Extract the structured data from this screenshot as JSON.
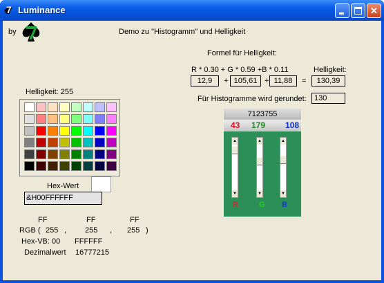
{
  "window": {
    "title": "Luminance"
  },
  "header": {
    "by": "by",
    "demo": "Demo zu \"Histogramm\" und Helligkeit"
  },
  "formula": {
    "title": "Formel für Helligkeit:",
    "expr": "R * 0.30  +  G * 0.59  +B  * 0.11",
    "result_label": "Helligkeit:",
    "r_term": "12,9",
    "g_term": "105,61",
    "b_term": "11,88",
    "plus1": "+",
    "plus2": "+",
    "equals": "=",
    "result": "130,39",
    "rounded_label": "Für Histogramme wird gerundet:",
    "rounded_value": "130"
  },
  "palette": {
    "brightness_label": "Helligkeit: 255",
    "colors": [
      [
        "#ffffff",
        "#ffc0c0",
        "#ffe0c0",
        "#ffffc0",
        "#c0ffc0",
        "#c0ffff",
        "#c0c0ff",
        "#ffc0ff"
      ],
      [
        "#e0e0e0",
        "#ff8080",
        "#ffc080",
        "#ffff80",
        "#80ff80",
        "#80ffff",
        "#8080ff",
        "#ff80ff"
      ],
      [
        "#c0c0c0",
        "#ff0000",
        "#ff8000",
        "#ffff00",
        "#00ff00",
        "#00ffff",
        "#0000ff",
        "#ff00ff"
      ],
      [
        "#808080",
        "#c00000",
        "#c04000",
        "#c0c000",
        "#00c000",
        "#00c0c0",
        "#0000c0",
        "#c000c0"
      ],
      [
        "#404040",
        "#800000",
        "#804000",
        "#808000",
        "#008000",
        "#008080",
        "#000080",
        "#800080"
      ],
      [
        "#000000",
        "#400000",
        "#402000",
        "#404000",
        "#004000",
        "#004040",
        "#000040",
        "#400040"
      ]
    ]
  },
  "hex": {
    "label": "Hex-Wert",
    "swatch_color": "#ffffff",
    "value": "&H00FFFFFF"
  },
  "histogram": {
    "value": "7123755",
    "r": "43",
    "g": "179",
    "b": "108",
    "r_color": "#e0142a",
    "g_color": "#1f8f1f",
    "b_color": "#1030c0",
    "r_label": "R",
    "g_label": "G",
    "b_label": "B",
    "label_r_color": "#c03030",
    "label_g_color": "#20d020",
    "label_b_color": "#1a3acc"
  },
  "info": {
    "hex_r": "FF",
    "hex_g": "FF",
    "hex_b": "FF",
    "rgb_prefix": "RGB (",
    "rgb_r": "255",
    "rgb_g": "255",
    "rgb_b": "255",
    "comma1": ",",
    "comma2": ",",
    "close": ")",
    "hexvb_label": "Hex-VB: 00",
    "hexvb_value": "FFFFFF",
    "dec_label": "Dezimalwert",
    "dec_value": "16777215"
  },
  "colors": {
    "titlebar": "#0552d8",
    "panel_green": "#2c8f58",
    "client_bg": "#ece9d8"
  }
}
